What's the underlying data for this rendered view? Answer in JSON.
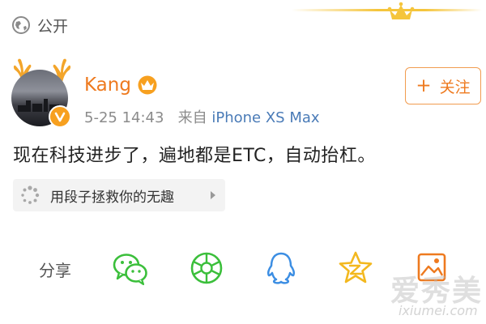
{
  "visibility": {
    "label": "公开",
    "icon": "globe-icon"
  },
  "user": {
    "name": "Kang",
    "badge_icon": "crown-icon",
    "verified_icon": "verified-v-icon",
    "verified_text": "v"
  },
  "meta": {
    "time": "5-25 14:43",
    "source_prefix": "来自",
    "device": "iPhone XS Max"
  },
  "follow_button": {
    "plus": "+",
    "label": "关注"
  },
  "post": {
    "text": "现在科技进步了，遍地都是ETC，自动抬杠。"
  },
  "topic": {
    "icon": "spinner-dots-icon",
    "label": "用段子拯救你的无趣"
  },
  "share": {
    "label": "分享",
    "targets": [
      {
        "name": "wechat",
        "icon": "wechat-icon",
        "color": "#3bbf3b"
      },
      {
        "name": "moments",
        "icon": "moments-icon",
        "color": "#3bbf3b"
      },
      {
        "name": "qq",
        "icon": "qq-icon",
        "color": "#3c8ee3"
      },
      {
        "name": "qzone",
        "icon": "qzone-star-icon",
        "color": "#f3b81e"
      },
      {
        "name": "weibo-album",
        "icon": "photo-frame-icon",
        "color": "#ee7a1f"
      }
    ]
  },
  "watermark": {
    "cn": "爱秀美",
    "url": "ixiumei.com"
  },
  "colors": {
    "accent": "#ee7a1f",
    "link": "#4a7bb7",
    "gold": "#f5c53c"
  }
}
